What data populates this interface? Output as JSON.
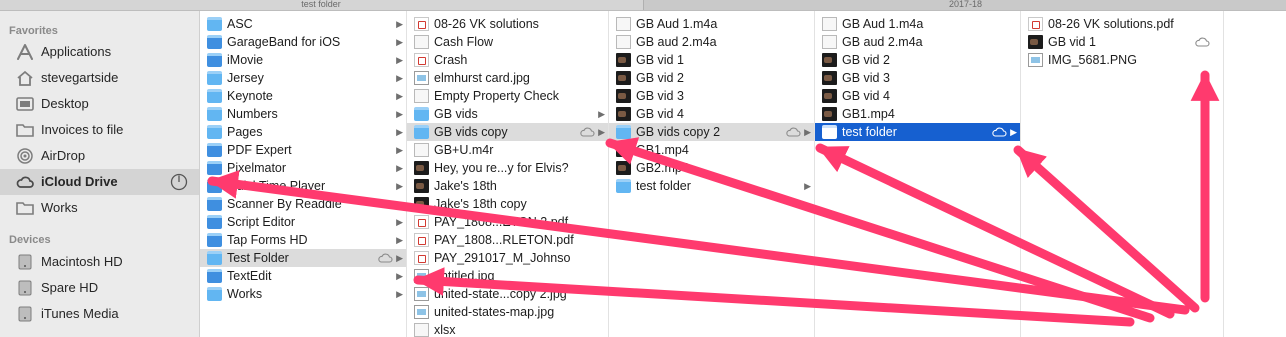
{
  "tabs": [
    {
      "label": "test folder"
    },
    {
      "label": "2017-18"
    }
  ],
  "sidebar": {
    "favorites_header": "Favorites",
    "devices_header": "Devices",
    "favorites": [
      {
        "label": "Applications",
        "icon": "applications-icon"
      },
      {
        "label": "stevegartside",
        "icon": "home-icon"
      },
      {
        "label": "Desktop",
        "icon": "desktop-folder-icon"
      },
      {
        "label": "Invoices to file",
        "icon": "folder-icon"
      },
      {
        "label": "AirDrop",
        "icon": "airdrop-icon"
      },
      {
        "label": "iCloud Drive",
        "icon": "cloud-icon"
      },
      {
        "label": "Works",
        "icon": "folder-icon"
      }
    ],
    "devices": [
      {
        "label": "Macintosh HD",
        "icon": "hard-drive-icon"
      },
      {
        "label": "Spare HD",
        "icon": "hard-drive-icon"
      },
      {
        "label": "iTunes Media",
        "icon": "hard-drive-icon"
      }
    ]
  },
  "columns": [
    {
      "items": [
        {
          "name": "ASC",
          "icon": "folder-icon",
          "chevron": true
        },
        {
          "name": "GarageBand for iOS",
          "icon": "app-folder-icon",
          "chevron": true
        },
        {
          "name": "iMovie",
          "icon": "app-folder-icon",
          "chevron": true
        },
        {
          "name": "Jersey",
          "icon": "folder-icon",
          "chevron": true
        },
        {
          "name": "Keynote",
          "icon": "folder-icon",
          "chevron": true
        },
        {
          "name": "Numbers",
          "icon": "folder-icon",
          "chevron": true
        },
        {
          "name": "Pages",
          "icon": "folder-icon",
          "chevron": true
        },
        {
          "name": "PDF Expert",
          "icon": "app-folder-icon",
          "chevron": true
        },
        {
          "name": "Pixelmator",
          "icon": "app-folder-icon",
          "chevron": true
        },
        {
          "name": "QuickTime Player",
          "icon": "app-folder-icon",
          "chevron": true
        },
        {
          "name": "Scanner By Readdle",
          "icon": "app-folder-icon",
          "chevron": true
        },
        {
          "name": "Script Editor",
          "icon": "app-folder-icon",
          "chevron": true
        },
        {
          "name": "Tap Forms HD",
          "icon": "app-folder-icon",
          "chevron": true
        },
        {
          "name": "Test Folder",
          "icon": "folder-icon",
          "chevron": true,
          "cloud": true,
          "highlight": true
        },
        {
          "name": "TextEdit",
          "icon": "app-folder-icon",
          "chevron": true
        },
        {
          "name": "Works",
          "icon": "folder-icon",
          "chevron": true
        }
      ]
    },
    {
      "items": [
        {
          "name": "08-26 VK solutions",
          "icon": "pdf-icon"
        },
        {
          "name": "Cash Flow",
          "icon": "document-icon"
        },
        {
          "name": "Crash",
          "icon": "pdf-icon"
        },
        {
          "name": "elmhurst card.jpg",
          "icon": "image-icon"
        },
        {
          "name": "Empty Property Check",
          "icon": "document-icon"
        },
        {
          "name": "GB vids",
          "icon": "folder-icon",
          "chevron": true
        },
        {
          "name": "GB vids copy",
          "icon": "folder-icon",
          "chevron": true,
          "cloud": true,
          "highlight": true
        },
        {
          "name": "GB+U.m4r",
          "icon": "document-icon"
        },
        {
          "name": "Hey, you re...y for Elvis?",
          "icon": "video-icon"
        },
        {
          "name": "Jake's 18th",
          "icon": "video-icon"
        },
        {
          "name": "Jake's 18th copy",
          "icon": "video-icon"
        },
        {
          "name": "PAY_1808...ETON 2.pdf",
          "icon": "pdf-icon"
        },
        {
          "name": "PAY_1808...RLETON.pdf",
          "icon": "pdf-icon"
        },
        {
          "name": "PAY_291017_M_Johnso",
          "icon": "pdf-icon"
        },
        {
          "name": "untitled.jpg",
          "icon": "image-icon"
        },
        {
          "name": "united-state...copy 2.jpg",
          "icon": "image-icon"
        },
        {
          "name": "united-states-map.jpg",
          "icon": "image-icon"
        },
        {
          "name": "xlsx",
          "icon": "document-icon"
        }
      ]
    },
    {
      "items": [
        {
          "name": "GB Aud 1.m4a",
          "icon": "audio-file-icon"
        },
        {
          "name": "GB aud 2.m4a",
          "icon": "audio-file-icon"
        },
        {
          "name": "GB vid 1",
          "icon": "video-icon"
        },
        {
          "name": "GB vid 2",
          "icon": "video-icon"
        },
        {
          "name": "GB vid 3",
          "icon": "video-icon"
        },
        {
          "name": "GB vid 4",
          "icon": "video-icon"
        },
        {
          "name": "GB vids copy 2",
          "icon": "folder-icon",
          "chevron": true,
          "cloud": true,
          "highlight": true
        },
        {
          "name": "GB1.mp4",
          "icon": "video-icon"
        },
        {
          "name": "GB2.mp4",
          "icon": "video-icon"
        },
        {
          "name": "test folder",
          "icon": "folder-icon",
          "chevron": true
        }
      ]
    },
    {
      "items": [
        {
          "name": "GB Aud 1.m4a",
          "icon": "audio-file-icon"
        },
        {
          "name": "GB aud 2.m4a",
          "icon": "audio-file-icon"
        },
        {
          "name": "GB vid 2",
          "icon": "video-icon"
        },
        {
          "name": "GB vid 3",
          "icon": "video-icon"
        },
        {
          "name": "GB vid 4",
          "icon": "video-icon"
        },
        {
          "name": "GB1.mp4",
          "icon": "video-icon"
        },
        {
          "name": "test folder",
          "icon": "folder-icon",
          "chevron": true,
          "cloud": true,
          "selected": true
        }
      ]
    },
    {
      "items": [
        {
          "name": "08-26 VK solutions.pdf",
          "icon": "pdf-icon"
        },
        {
          "name": "GB vid 1",
          "icon": "video-icon",
          "cloud": true
        },
        {
          "name": "IMG_5681.PNG",
          "icon": "image-icon"
        }
      ]
    }
  ],
  "colors": {
    "annotation_arrow": "#ff3a6e",
    "selection": "#1660d0",
    "highlight": "#dcdcdc",
    "sidebar_bg": "#ebebeb"
  }
}
